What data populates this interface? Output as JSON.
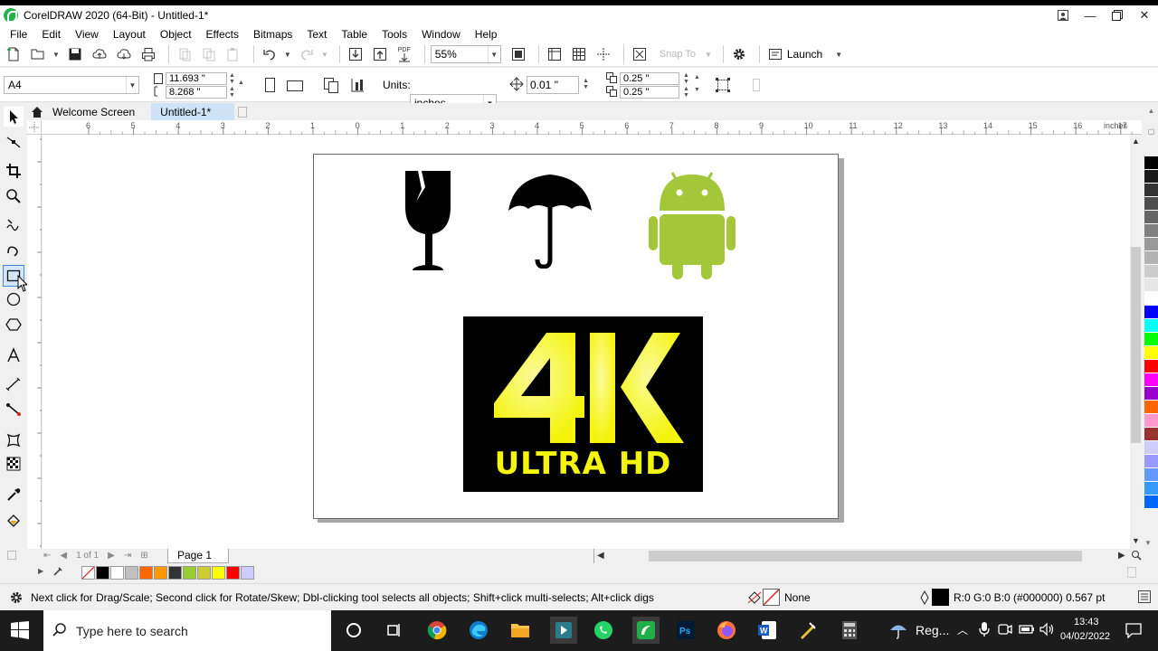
{
  "window": {
    "title": "CorelDRAW 2020 (64-Bit) - Untitled-1*"
  },
  "menu": [
    "File",
    "Edit",
    "View",
    "Layout",
    "Object",
    "Effects",
    "Bitmaps",
    "Text",
    "Table",
    "Tools",
    "Window",
    "Help"
  ],
  "toolbar": {
    "zoom": "55%",
    "snap_to": "Snap To",
    "launch": "Launch",
    "pdf_label": "PDF"
  },
  "propbar": {
    "page_size": "A4",
    "width": "11.693 \"",
    "height": "8.268 \"",
    "units_label": "Units:",
    "units_value": "inches",
    "nudge": "0.01 \"",
    "dup_x": "0.25 \"",
    "dup_y": "0.25 \""
  },
  "tabs": {
    "welcome": "Welcome Screen",
    "doc": "Untitled-1*"
  },
  "ruler": {
    "h_labels": [
      "6",
      "5",
      "4",
      "3",
      "2",
      "1",
      "0",
      "1",
      "2",
      "3",
      "4",
      "5",
      "6",
      "7",
      "8",
      "9",
      "10",
      "11",
      "12",
      "13",
      "14",
      "15",
      "16",
      "17"
    ],
    "unit": "inches"
  },
  "artwork": {
    "logo_4k": "4K",
    "logo_sub": "ULTRA HD",
    "android_color": "#a4c639",
    "logo_yellow": "#f4f40c"
  },
  "page_nav": {
    "page_of": "1 of 1",
    "page_tab": "Page 1"
  },
  "palette_colors": [
    "#000000",
    "#1a1a1a",
    "#333333",
    "#4d4d4d",
    "#666666",
    "#808080",
    "#999999",
    "#b3b3b3",
    "#cccccc",
    "#e6e6e6",
    "#ffffff",
    "#0000ff",
    "#00ffff",
    "#00ff00",
    "#ffff00",
    "#ff0000",
    "#ff00ff",
    "#9900cc",
    "#ff6600",
    "#ff99cc",
    "#993333",
    "#ccccff",
    "#9999ff",
    "#6699ff",
    "#3399ff",
    "#0066ff"
  ],
  "doc_palette_colors": [
    "#000000",
    "#ffffff",
    "#c0c0c0",
    "#ff6600",
    "#ff9900",
    "#333333",
    "#99cc33",
    "#cccc33",
    "#ffff00",
    "#ff0000",
    "#ccccff"
  ],
  "status": {
    "hint": "Next click for Drag/Scale; Second click for Rotate/Skew; Dbl-clicking tool selects all objects; Shift+click multi-selects; Alt+click digs",
    "fill_label": "None",
    "outline_info": "R:0 G:0 B:0 (#000000)  0.567 pt"
  },
  "taskbar": {
    "search_placeholder": "Type here to search",
    "weather": "Reg...",
    "time": "13:43",
    "date": "04/02/2022"
  }
}
